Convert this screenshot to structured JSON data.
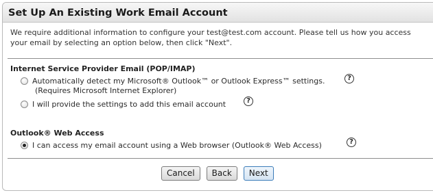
{
  "header": {
    "title": "Set Up An Existing Work Email Account"
  },
  "intro": {
    "line1": "We require additional information to configure your test@test.com account. Please tell us how you access",
    "line2": "your email by selecting an option below, then click \"Next\"."
  },
  "sections": [
    {
      "title": "Internet Service Provider Email (POP/IMAP)",
      "options": [
        {
          "label": "Automatically detect my Microsoft® Outlook™ or Outlook Express™ settings.",
          "sublabel": "(Requires Microsoft Internet Explorer)",
          "selected": false,
          "help": "?"
        },
        {
          "label": "I will provide the settings to add this email account",
          "selected": false,
          "help": "?"
        }
      ]
    },
    {
      "title": "Outlook® Web Access",
      "options": [
        {
          "label": "I can access my email account using a Web browser (Outlook® Web Access)",
          "selected": true,
          "help": "?"
        }
      ]
    }
  ],
  "buttons": {
    "cancel": "Cancel",
    "back": "Back",
    "next": "Next"
  }
}
